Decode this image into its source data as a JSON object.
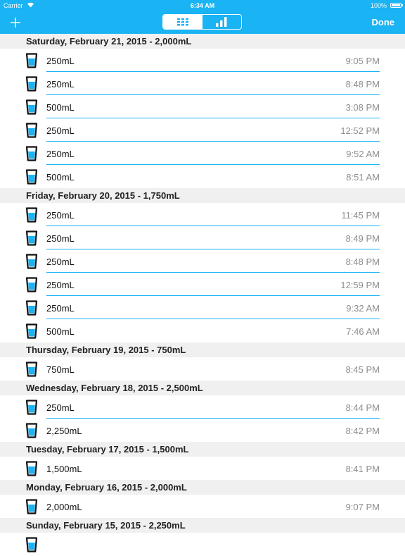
{
  "status_bar": {
    "carrier": "Carrier",
    "time": "6:34 AM",
    "battery": "100%"
  },
  "nav": {
    "done_label": "Done",
    "add_icon": "plus-icon",
    "segments": [
      "list-icon",
      "chart-icon"
    ]
  },
  "colors": {
    "accent": "#1ab3f3",
    "section_bg": "#f0f0f0",
    "time_text": "#8e8e93"
  },
  "days": [
    {
      "header": "Saturday, February 21, 2015 - 2,000mL",
      "entries": [
        {
          "amount": "250mL",
          "time": "9:05 PM"
        },
        {
          "amount": "250mL",
          "time": "8:48 PM"
        },
        {
          "amount": "500mL",
          "time": "3:08 PM"
        },
        {
          "amount": "250mL",
          "time": "12:52 PM"
        },
        {
          "amount": "250mL",
          "time": "9:52 AM"
        },
        {
          "amount": "500mL",
          "time": "8:51 AM"
        }
      ]
    },
    {
      "header": "Friday, February 20, 2015 - 1,750mL",
      "entries": [
        {
          "amount": "250mL",
          "time": "11:45 PM"
        },
        {
          "amount": "250mL",
          "time": "8:49 PM"
        },
        {
          "amount": "250mL",
          "time": "8:48 PM"
        },
        {
          "amount": "250mL",
          "time": "12:59 PM"
        },
        {
          "amount": "250mL",
          "time": "9:32 AM"
        },
        {
          "amount": "500mL",
          "time": "7:46 AM"
        }
      ]
    },
    {
      "header": "Thursday, February 19, 2015 - 750mL",
      "entries": [
        {
          "amount": "750mL",
          "time": "8:45 PM"
        }
      ]
    },
    {
      "header": "Wednesday, February 18, 2015 - 2,500mL",
      "entries": [
        {
          "amount": "250mL",
          "time": "8:44 PM"
        },
        {
          "amount": "2,250mL",
          "time": "8:42 PM"
        }
      ]
    },
    {
      "header": "Tuesday, February 17, 2015 - 1,500mL",
      "entries": [
        {
          "amount": "1,500mL",
          "time": "8:41 PM"
        }
      ]
    },
    {
      "header": "Monday, February 16, 2015 - 2,000mL",
      "entries": [
        {
          "amount": "2,000mL",
          "time": "9:07 PM"
        }
      ]
    },
    {
      "header": "Sunday, February 15, 2015 - 2,250mL",
      "entries": [
        {
          "amount": "",
          "time": ""
        }
      ]
    }
  ]
}
